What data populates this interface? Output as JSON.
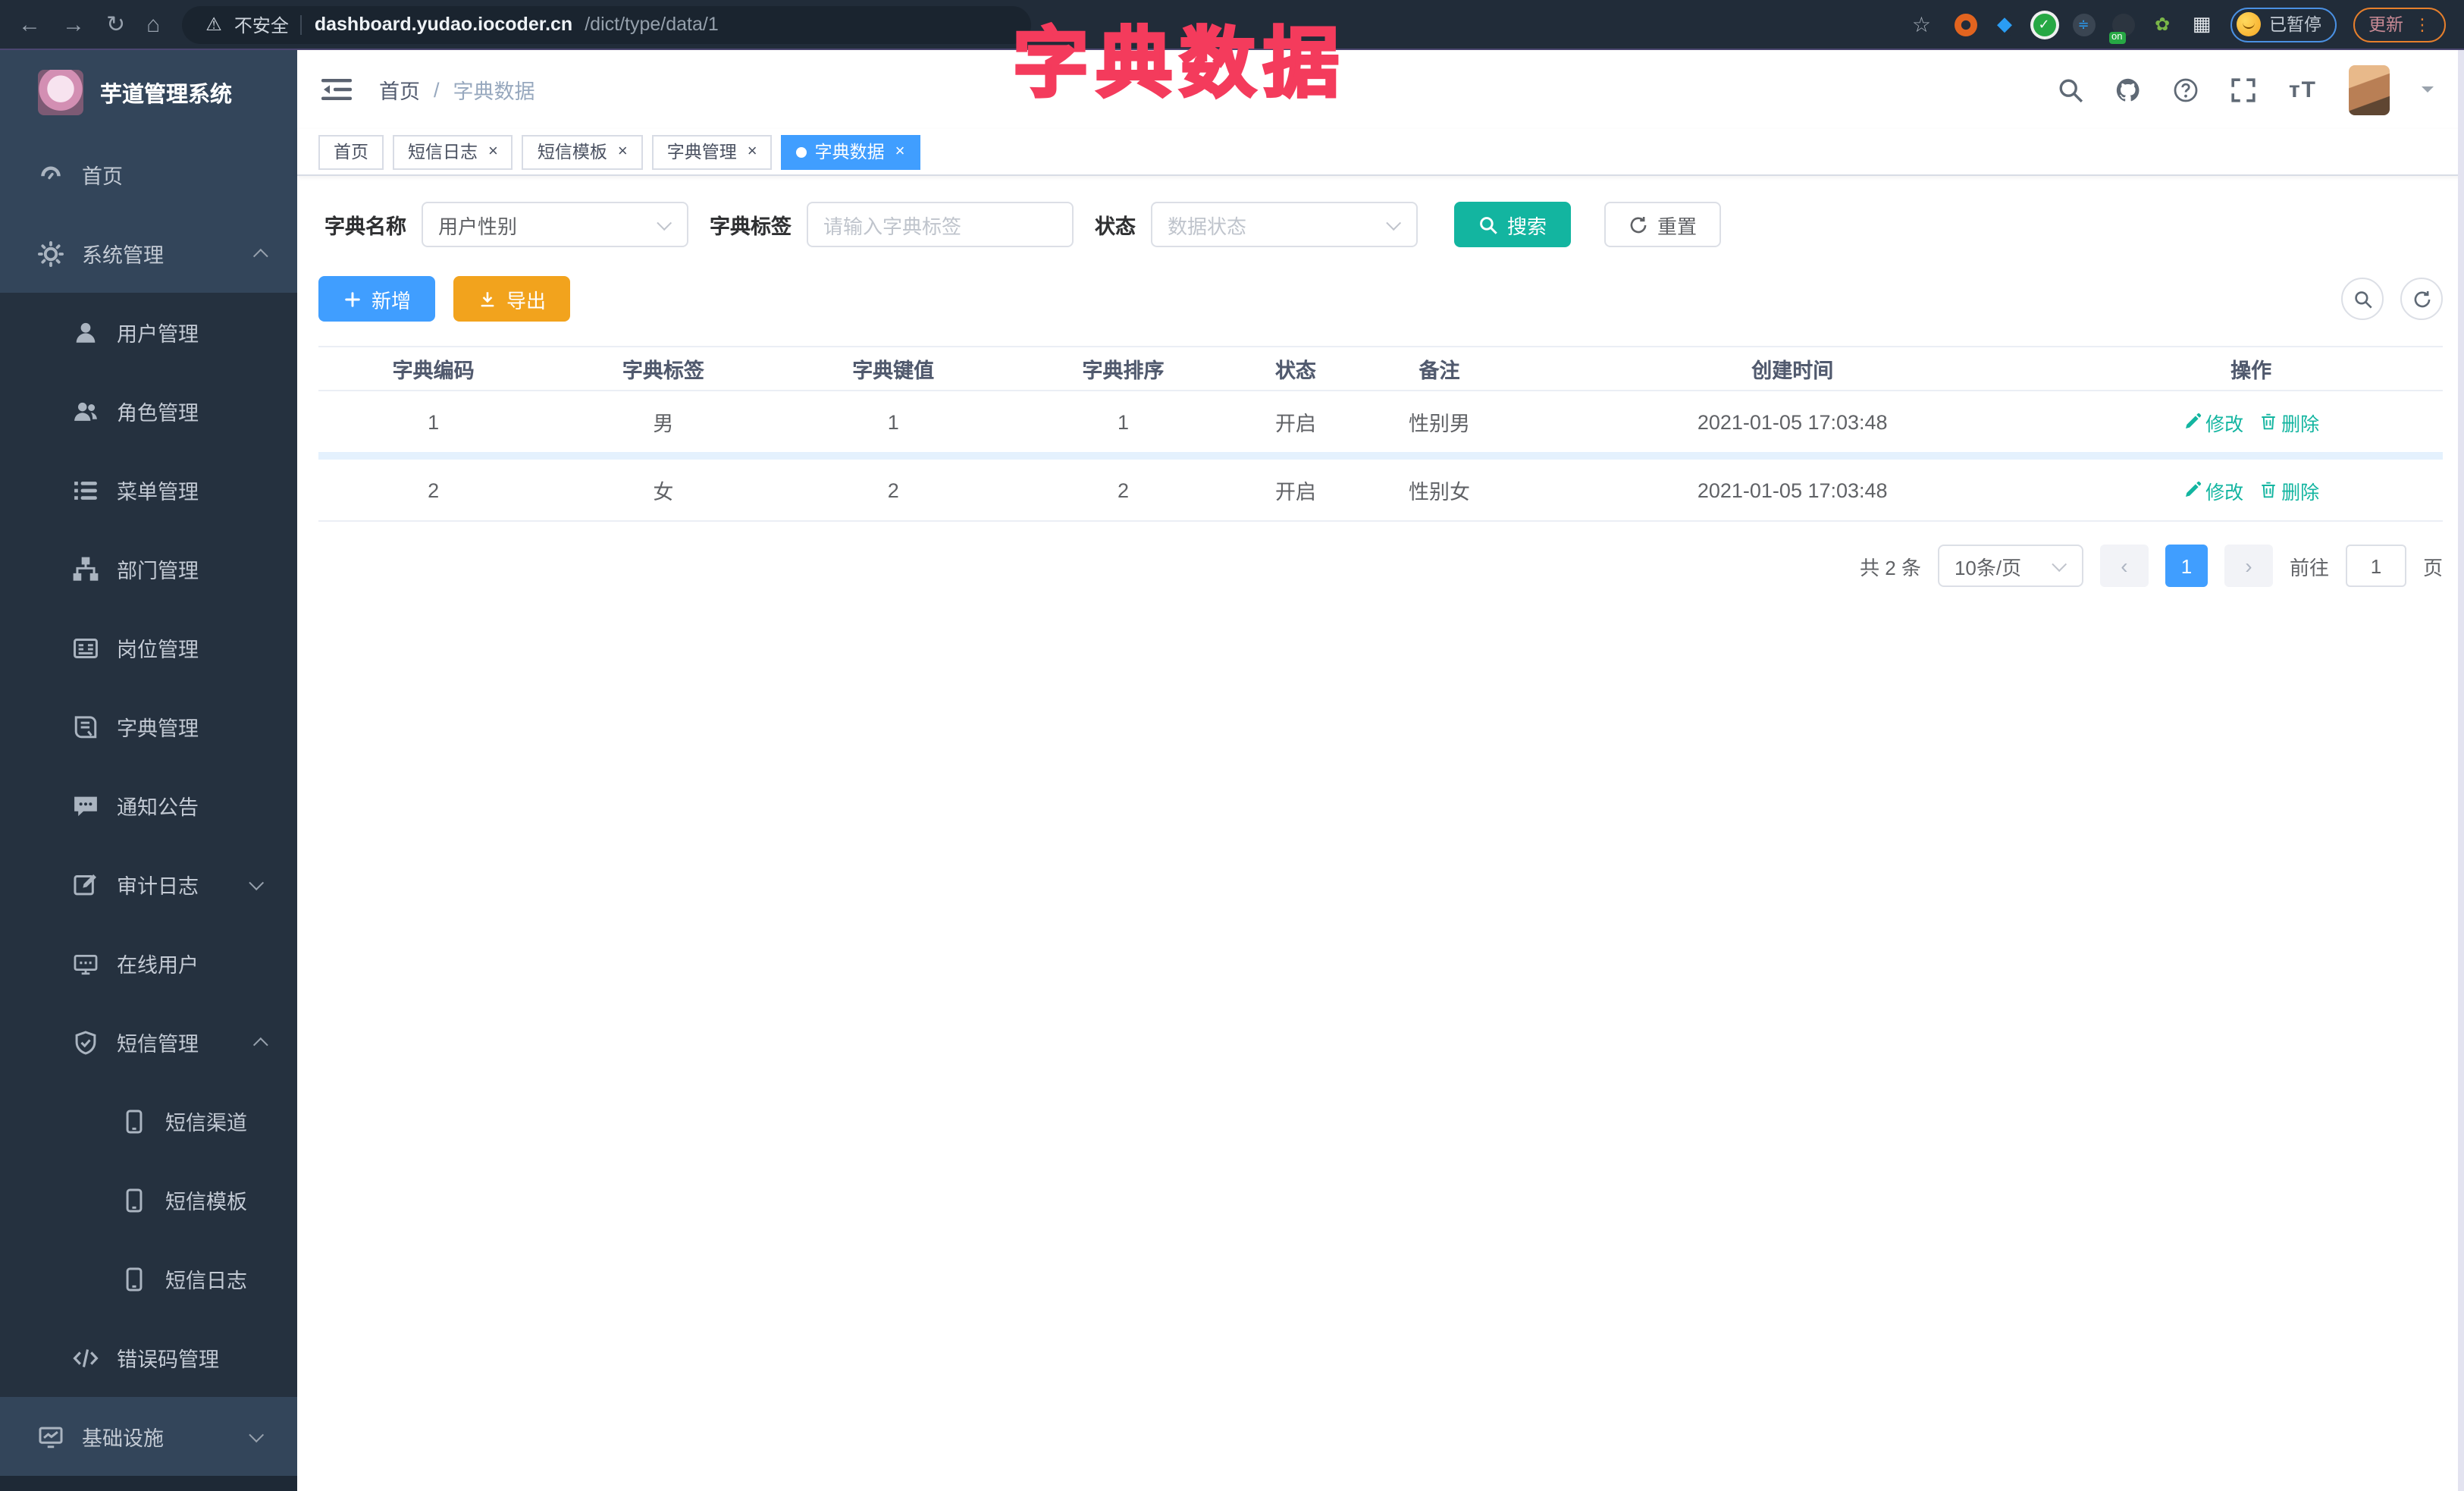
{
  "browser": {
    "security_label": "不安全",
    "url_domain": "dashboard.yudao.iocoder.cn",
    "url_path": "/dict/type/data/1",
    "paused_badge": "已暂停",
    "update_button": "更新",
    "extension_on_badge": "on",
    "extension_icons": [
      "orange-ring-extension-icon",
      "blue-drop-extension-icon",
      "green-check-extension-icon",
      "sliders-extension-icon",
      "dark-on-extension-icon",
      "green-leaf-extension-icon",
      "puzzle-extension-icon"
    ]
  },
  "annotation": {
    "title": "字典数据",
    "color": "#f43b5c"
  },
  "sidebar": {
    "logo_title": "芋道管理系统",
    "items": [
      {
        "id": "home",
        "label": "首页",
        "icon": "dashboard",
        "depth": 0,
        "section": "top"
      },
      {
        "id": "system-mgmt",
        "label": "系统管理",
        "icon": "gear",
        "depth": 0,
        "section": "top",
        "caret": "up"
      },
      {
        "id": "user-mgmt",
        "label": "用户管理",
        "icon": "user",
        "depth": 1
      },
      {
        "id": "role-mgmt",
        "label": "角色管理",
        "icon": "users",
        "depth": 1
      },
      {
        "id": "menu-mgmt",
        "label": "菜单管理",
        "icon": "menu-list",
        "depth": 1
      },
      {
        "id": "dept-mgmt",
        "label": "部门管理",
        "icon": "org-tree",
        "depth": 1
      },
      {
        "id": "post-mgmt",
        "label": "岗位管理",
        "icon": "id-card",
        "depth": 1
      },
      {
        "id": "dict-mgmt",
        "label": "字典管理",
        "icon": "book",
        "depth": 1
      },
      {
        "id": "notice",
        "label": "通知公告",
        "icon": "announcement",
        "depth": 1
      },
      {
        "id": "audit-log",
        "label": "审计日志",
        "icon": "audit",
        "depth": 1,
        "caret": "down"
      },
      {
        "id": "online-users",
        "label": "在线用户",
        "icon": "online",
        "depth": 1
      },
      {
        "id": "sms-mgmt",
        "label": "短信管理",
        "icon": "shield-check",
        "depth": 1,
        "caret": "up"
      },
      {
        "id": "sms-channel",
        "label": "短信渠道",
        "icon": "phone",
        "depth": 2
      },
      {
        "id": "sms-template",
        "label": "短信模板",
        "icon": "phone",
        "depth": 2
      },
      {
        "id": "sms-log",
        "label": "短信日志",
        "icon": "phone",
        "depth": 2
      },
      {
        "id": "error-code-mgmt",
        "label": "错误码管理",
        "icon": "code",
        "depth": 1
      },
      {
        "id": "infrastructure",
        "label": "基础设施",
        "icon": "infra",
        "depth": 0,
        "section": "top",
        "caret": "down"
      }
    ]
  },
  "header": {
    "breadcrumb": [
      "首页",
      "字典数据"
    ],
    "breadcrumb_separator": "/"
  },
  "tabs": [
    {
      "id": "home",
      "label": "首页",
      "closable": false,
      "active": false
    },
    {
      "id": "sms-log",
      "label": "短信日志",
      "closable": true,
      "active": false
    },
    {
      "id": "sms-template",
      "label": "短信模板",
      "closable": true,
      "active": false
    },
    {
      "id": "dict-mgmt",
      "label": "字典管理",
      "closable": true,
      "active": false
    },
    {
      "id": "dict-data",
      "label": "字典数据",
      "closable": true,
      "active": true
    }
  ],
  "filters": {
    "name_label": "字典名称",
    "name_value": "用户性别",
    "tag_label": "字典标签",
    "tag_placeholder": "请输入字典标签",
    "status_label": "状态",
    "status_placeholder": "数据状态",
    "search_button": "搜索",
    "reset_button": "重置"
  },
  "toolbar": {
    "add_button": "新增",
    "export_button": "导出"
  },
  "table": {
    "headers": [
      "字典编码",
      "字典标签",
      "字典键值",
      "字典排序",
      "状态",
      "备注",
      "创建时间",
      "操作"
    ],
    "rows": [
      {
        "code": "1",
        "label": "男",
        "value": "1",
        "sort": "1",
        "status": "开启",
        "remark": "性别男",
        "created": "2021-01-05 17:03:48",
        "actions": [
          "修改",
          "删除"
        ]
      },
      {
        "code": "2",
        "label": "女",
        "value": "2",
        "sort": "2",
        "status": "开启",
        "remark": "性别女",
        "created": "2021-01-05 17:03:48",
        "actions": [
          "修改",
          "删除"
        ]
      }
    ]
  },
  "pagination": {
    "total": "共 2 条",
    "page_size": "10条/页",
    "prev": "‹",
    "current": "1",
    "next": "›",
    "goto_prefix": "前往",
    "goto_value": "1",
    "goto_suffix": "页"
  },
  "colors": {
    "primary_blue": "#409eff",
    "teal_accent": "#13b5a0",
    "warning_orange": "#f2a31d",
    "sidebar_bg": "#33455a",
    "sidebar_submenu_bg": "#25313f",
    "annotation_pink": "#f43b5c"
  }
}
